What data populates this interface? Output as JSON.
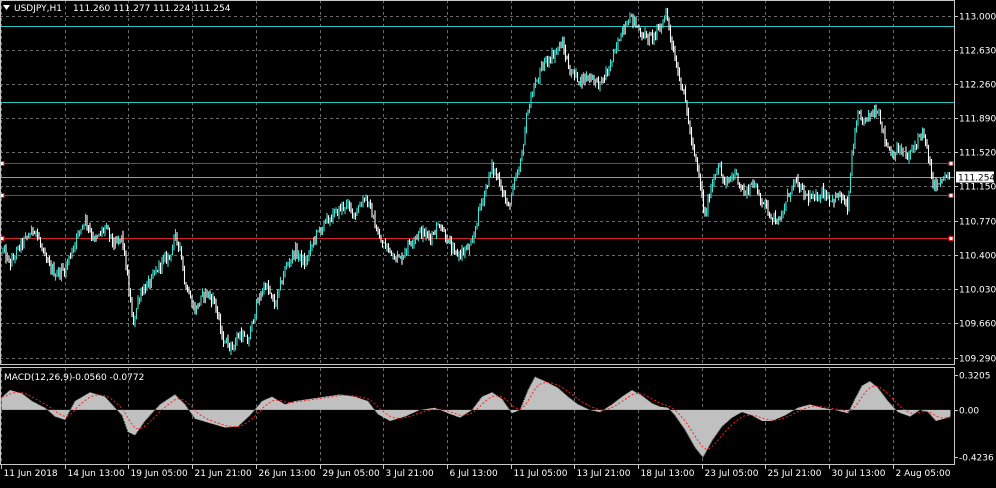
{
  "header": {
    "symbol": "USDJPY,H1",
    "ohlc": "111.260 111.277 111.224 111.254"
  },
  "macd_header": {
    "label": "MACD(12,26,9)",
    "values": "-0.0560 -0.0772"
  },
  "colors": {
    "background": "#000000",
    "candles": "#3fe0d0",
    "candles_down": "#ffffff",
    "grid": "#6b6b6b",
    "frame": "#c8c8c8",
    "hline_cyan": "#28c8c8",
    "hline_red": "#d42020",
    "macd_hist": "#c0c0c0",
    "macd_signal": "#ff2020",
    "price_tag_bg": "#ffffff",
    "price_tag_text": "#000000"
  },
  "chart_data": [
    {
      "type": "line",
      "name": "price",
      "title": "USDJPY,H1",
      "y_ticks": [
        "113.000",
        "112.630",
        "112.260",
        "111.890",
        "111.520",
        "111.150",
        "110.770",
        "110.400",
        "110.030",
        "109.660",
        "109.290"
      ],
      "ylim": [
        109.22,
        113.17
      ],
      "current_price": "111.254",
      "x_labels": [
        "11 Jun 2018",
        "14 Jun 13:00",
        "19 Jun 05:00",
        "21 Jun 21:00",
        "26 Jun 13:00",
        "29 Jun 05:00",
        "3 Jul 21:00",
        "6 Jul 13:00",
        "11 Jul 05:00",
        "13 Jul 21:00",
        "18 Jul 13:00",
        "23 Jul 05:00",
        "25 Jul 21:00",
        "30 Jul 13:00",
        "2 Aug 05:00"
      ],
      "horizontal_lines": [
        {
          "price": 112.89,
          "color": "cyan"
        },
        {
          "price": 112.06,
          "color": "cyan"
        },
        {
          "price": 111.4,
          "color": "red"
        },
        {
          "price": 111.05,
          "color": "red"
        },
        {
          "price": 110.59,
          "color": "red"
        }
      ],
      "keypoints": [
        [
          0,
          110.15
        ],
        [
          3,
          110.45
        ],
        [
          10,
          110.3
        ],
        [
          20,
          110.5
        ],
        [
          35,
          110.7
        ],
        [
          45,
          110.35
        ],
        [
          55,
          110.2
        ],
        [
          65,
          110.25
        ],
        [
          75,
          110.55
        ],
        [
          85,
          110.8
        ],
        [
          95,
          110.55
        ],
        [
          105,
          110.7
        ],
        [
          115,
          110.5
        ],
        [
          122,
          110.6
        ],
        [
          127,
          110.2
        ],
        [
          133,
          109.65
        ],
        [
          140,
          110.0
        ],
        [
          150,
          110.1
        ],
        [
          160,
          110.3
        ],
        [
          170,
          110.4
        ],
        [
          175,
          110.6
        ],
        [
          180,
          110.5
        ],
        [
          185,
          110.1
        ],
        [
          195,
          109.8
        ],
        [
          205,
          110.0
        ],
        [
          215,
          109.9
        ],
        [
          222,
          109.5
        ],
        [
          232,
          109.4
        ],
        [
          240,
          109.55
        ],
        [
          248,
          109.45
        ],
        [
          255,
          109.8
        ],
        [
          265,
          110.1
        ],
        [
          275,
          109.85
        ],
        [
          285,
          110.25
        ],
        [
          295,
          110.45
        ],
        [
          305,
          110.3
        ],
        [
          315,
          110.6
        ],
        [
          325,
          110.75
        ],
        [
          335,
          110.85
        ],
        [
          345,
          110.95
        ],
        [
          355,
          110.85
        ],
        [
          365,
          111.05
        ],
        [
          372,
          110.85
        ],
        [
          380,
          110.55
        ],
        [
          390,
          110.45
        ],
        [
          400,
          110.35
        ],
        [
          410,
          110.55
        ],
        [
          420,
          110.65
        ],
        [
          430,
          110.6
        ],
        [
          440,
          110.75
        ],
        [
          448,
          110.55
        ],
        [
          455,
          110.4
        ],
        [
          465,
          110.45
        ],
        [
          472,
          110.5
        ],
        [
          478,
          110.85
        ],
        [
          485,
          111.1
        ],
        [
          492,
          111.35
        ],
        [
          500,
          111.2
        ],
        [
          508,
          110.9
        ],
        [
          515,
          111.2
        ],
        [
          520,
          111.35
        ],
        [
          528,
          112.0
        ],
        [
          535,
          112.25
        ],
        [
          545,
          112.5
        ],
        [
          555,
          112.6
        ],
        [
          562,
          112.7
        ],
        [
          570,
          112.4
        ],
        [
          580,
          112.3
        ],
        [
          590,
          112.35
        ],
        [
          600,
          112.25
        ],
        [
          608,
          112.4
        ],
        [
          615,
          112.6
        ],
        [
          622,
          112.85
        ],
        [
          630,
          113.0
        ],
        [
          636,
          112.9
        ],
        [
          642,
          112.8
        ],
        [
          650,
          112.75
        ],
        [
          660,
          112.85
        ],
        [
          666,
          113.05
        ],
        [
          672,
          112.7
        ],
        [
          678,
          112.4
        ],
        [
          685,
          112.1
        ],
        [
          692,
          111.6
        ],
        [
          700,
          111.2
        ],
        [
          705,
          110.8
        ],
        [
          710,
          111.1
        ],
        [
          718,
          111.4
        ],
        [
          725,
          111.15
        ],
        [
          735,
          111.3
        ],
        [
          745,
          111.05
        ],
        [
          752,
          111.2
        ],
        [
          762,
          111.0
        ],
        [
          770,
          110.85
        ],
        [
          780,
          110.75
        ],
        [
          788,
          111.05
        ],
        [
          795,
          111.2
        ],
        [
          805,
          111.05
        ],
        [
          815,
          111.0
        ],
        [
          822,
          111.1
        ],
        [
          832,
          111.0
        ],
        [
          840,
          111.05
        ],
        [
          848,
          110.9
        ],
        [
          852,
          111.5
        ],
        [
          858,
          111.9
        ],
        [
          865,
          111.85
        ],
        [
          872,
          111.95
        ],
        [
          878,
          112.0
        ],
        [
          885,
          111.65
        ],
        [
          892,
          111.5
        ],
        [
          900,
          111.55
        ],
        [
          908,
          111.45
        ],
        [
          915,
          111.6
        ],
        [
          922,
          111.75
        ],
        [
          928,
          111.5
        ],
        [
          932,
          111.2
        ],
        [
          938,
          111.15
        ],
        [
          944,
          111.25
        ],
        [
          950,
          111.25
        ]
      ]
    },
    {
      "type": "area",
      "name": "MACD",
      "title": "MACD(12,26,9)",
      "y_ticks": [
        "0.3205",
        "0.00",
        "-0.4236"
      ],
      "ylim": [
        -0.49,
        0.38
      ],
      "histogram": [
        [
          0,
          0.1
        ],
        [
          10,
          0.18
        ],
        [
          22,
          0.15
        ],
        [
          32,
          0.08
        ],
        [
          45,
          0.02
        ],
        [
          55,
          -0.06
        ],
        [
          65,
          -0.09
        ],
        [
          75,
          0.08
        ],
        [
          90,
          0.16
        ],
        [
          105,
          0.12
        ],
        [
          115,
          0.02
        ],
        [
          122,
          -0.05
        ],
        [
          128,
          -0.2
        ],
        [
          135,
          -0.23
        ],
        [
          145,
          -0.1
        ],
        [
          160,
          0.05
        ],
        [
          175,
          0.14
        ],
        [
          185,
          0.05
        ],
        [
          195,
          -0.08
        ],
        [
          210,
          -0.12
        ],
        [
          225,
          -0.16
        ],
        [
          238,
          -0.15
        ],
        [
          250,
          -0.05
        ],
        [
          262,
          0.08
        ],
        [
          272,
          0.12
        ],
        [
          285,
          0.05
        ],
        [
          295,
          0.08
        ],
        [
          310,
          0.1
        ],
        [
          325,
          0.12
        ],
        [
          340,
          0.14
        ],
        [
          355,
          0.12
        ],
        [
          368,
          0.08
        ],
        [
          378,
          -0.04
        ],
        [
          390,
          -0.1
        ],
        [
          405,
          -0.06
        ],
        [
          420,
          0.0
        ],
        [
          435,
          0.02
        ],
        [
          448,
          -0.03
        ],
        [
          460,
          -0.07
        ],
        [
          472,
          0.0
        ],
        [
          482,
          0.12
        ],
        [
          492,
          0.16
        ],
        [
          502,
          0.1
        ],
        [
          512,
          -0.03
        ],
        [
          520,
          0.0
        ],
        [
          528,
          0.18
        ],
        [
          535,
          0.3
        ],
        [
          545,
          0.26
        ],
        [
          558,
          0.2
        ],
        [
          568,
          0.12
        ],
        [
          578,
          0.05
        ],
        [
          590,
          0.0
        ],
        [
          600,
          -0.02
        ],
        [
          612,
          0.05
        ],
        [
          622,
          0.12
        ],
        [
          632,
          0.18
        ],
        [
          642,
          0.13
        ],
        [
          652,
          0.06
        ],
        [
          660,
          0.03
        ],
        [
          668,
          0.02
        ],
        [
          675,
          -0.05
        ],
        [
          685,
          -0.18
        ],
        [
          695,
          -0.34
        ],
        [
          703,
          -0.43
        ],
        [
          712,
          -0.28
        ],
        [
          722,
          -0.15
        ],
        [
          732,
          -0.07
        ],
        [
          742,
          -0.02
        ],
        [
          752,
          -0.05
        ],
        [
          762,
          -0.1
        ],
        [
          772,
          -0.1
        ],
        [
          785,
          -0.05
        ],
        [
          798,
          0.02
        ],
        [
          810,
          0.05
        ],
        [
          822,
          0.02
        ],
        [
          835,
          0.0
        ],
        [
          848,
          -0.03
        ],
        [
          855,
          0.1
        ],
        [
          862,
          0.22
        ],
        [
          870,
          0.26
        ],
        [
          878,
          0.2
        ],
        [
          888,
          0.08
        ],
        [
          898,
          -0.02
        ],
        [
          910,
          -0.06
        ],
        [
          920,
          0.0
        ],
        [
          928,
          -0.02
        ],
        [
          936,
          -0.1
        ],
        [
          944,
          -0.08
        ],
        [
          950,
          -0.06
        ]
      ]
    }
  ]
}
